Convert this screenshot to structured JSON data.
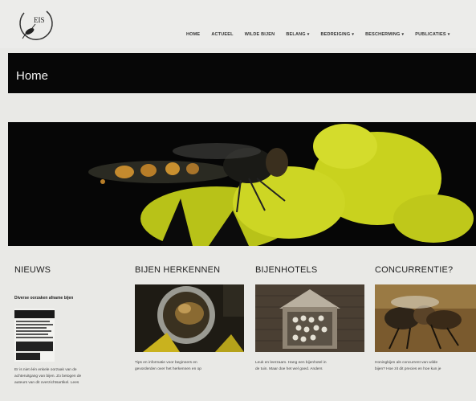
{
  "site": {
    "logo_text": "EIS"
  },
  "nav": {
    "items": [
      {
        "label": "HOME",
        "has_dropdown": false
      },
      {
        "label": "ACTUEEL",
        "has_dropdown": false
      },
      {
        "label": "WILDE BIJEN",
        "has_dropdown": false
      },
      {
        "label": "BELANG",
        "has_dropdown": true
      },
      {
        "label": "BEDREIGING",
        "has_dropdown": true
      },
      {
        "label": "BESCHERMING",
        "has_dropdown": true
      },
      {
        "label": "PUBLICATIES",
        "has_dropdown": true
      }
    ],
    "chevron": "▾"
  },
  "page": {
    "title": "Home"
  },
  "columns": {
    "news": {
      "heading": "NIEUWS",
      "headline": "Diverse oorzaken afname bijen",
      "teaser_1": "Er is niet één enkele oorzaak van de",
      "teaser_2": "achteruitgang van bijen. Zo betogen de",
      "teaser_3": "auteurs van dit overzichtsartikel. Lees"
    },
    "recognize": {
      "heading": "BIJEN HERKENNEN",
      "teaser_1": "Tips en informatie voor beginners en",
      "teaser_2": "gevorderden over het herkennen en op"
    },
    "hotels": {
      "heading": "BIJENHOTELS",
      "teaser_1": "Leuk en leerzaam. Hang een bijenhotel in",
      "teaser_2": "de tuin. Maar doe het wel goed. Anders"
    },
    "competition": {
      "heading": "CONCURRENTIE?",
      "teaser_1": "Honingbijen als concurrent van wilde",
      "teaser_2": "bijen? Hoe zit dit precies en hoe kun je"
    }
  },
  "colors": {
    "page_bg": "#e9e9e6",
    "title_bar_bg": "#070707",
    "flower_yellow": "#c9d21e"
  }
}
